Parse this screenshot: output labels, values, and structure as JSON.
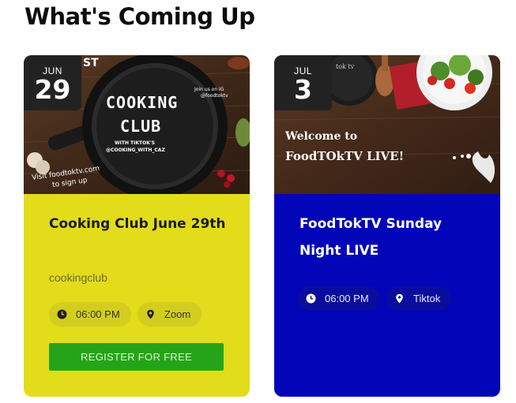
{
  "heading": "What's Coming Up",
  "events": [
    {
      "month": "JUN",
      "day": "29",
      "title": "Cooking Club June 29th",
      "category": "cookingclub",
      "time": "06:00 PM",
      "location": "Zoom",
      "register_label": "REGISTER FOR FREE",
      "banner": {
        "headline_1": "COOKING",
        "headline_2": "CLUB",
        "sub_1": "WITH TIKTOK'S",
        "sub_2": "@COOKING_WITH_CAZ",
        "join_1": "Join us on IG",
        "join_2": "@foodtoktv",
        "visit_1": "Visit foodtoktv.com",
        "visit_2": "to sign up",
        "corner": "ST"
      },
      "accent": "#e2dc1a"
    },
    {
      "month": "JUL",
      "day": "3",
      "title": "FoodTokTV Sunday Night LIVE",
      "time": "06:00 PM",
      "location": "Tiktok",
      "banner": {
        "line_1": "Welcome to",
        "line_2": "FoodTOkTV LIVE!",
        "logo_text": "tok tv"
      },
      "accent": "#0205b8"
    }
  ],
  "icons": {
    "time": "clock-icon",
    "location": "map-pin-icon"
  }
}
